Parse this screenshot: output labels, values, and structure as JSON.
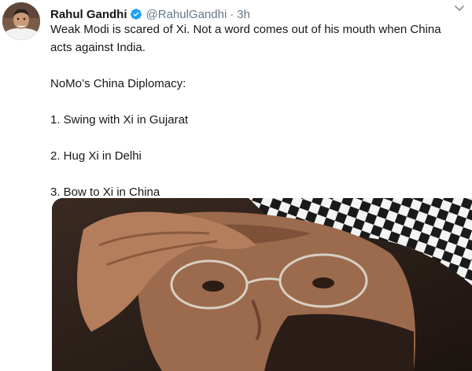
{
  "tweet": {
    "author_name": "Rahul Gandhi",
    "author_handle": "@RahulGandhi",
    "separator": "·",
    "time": "3h",
    "verified_icon": "verified-badge-icon",
    "menu_icon": "chevron-down-icon",
    "verified_color": "#1da1f2",
    "text_lines": [
      "Weak Modi is scared of Xi. Not a word comes out of his mouth when China acts against India.",
      "NoMo’s China Diplomacy:",
      "1. Swing with Xi in Gujarat",
      "2. Hug Xi in Delhi",
      "3. Bow to Xi in China"
    ]
  }
}
